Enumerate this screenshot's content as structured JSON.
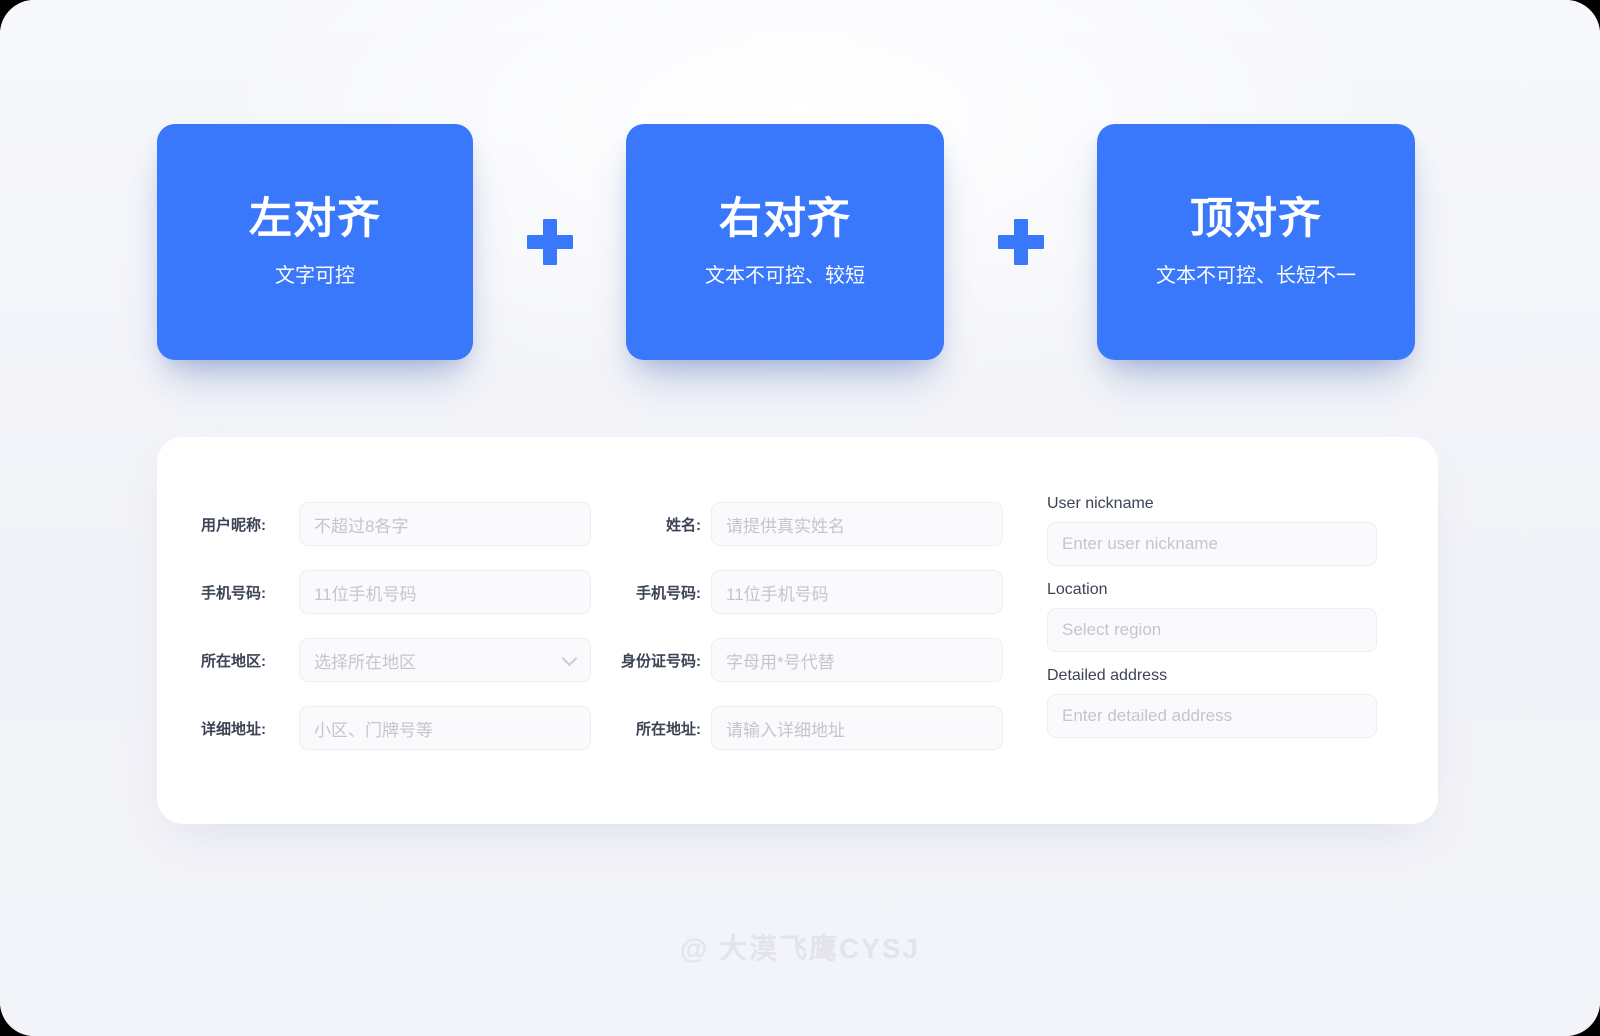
{
  "theme": {
    "accent_blue": "#3a78fb",
    "panel_bg": "#ffffff",
    "canvas_bg": "#f6f7fb",
    "label_color": "#3c4354",
    "placeholder_color": "#c3c6cd",
    "input_bg": "#fafafc",
    "input_border": "#edeef1",
    "watermark_color": "#e2e4ea"
  },
  "cards": [
    {
      "title": "左对齐",
      "subtitle": "文字可控"
    },
    {
      "title": "右对齐",
      "subtitle": "文本不可控、较短"
    },
    {
      "title": "顶对齐",
      "subtitle": "文本不可控、长短不一"
    }
  ],
  "separators": [
    {
      "icon": "plus-icon",
      "glyph": "+"
    },
    {
      "icon": "plus-icon",
      "glyph": "+"
    }
  ],
  "form": {
    "left_column": {
      "alignment": "left",
      "fields": [
        {
          "label": "用户昵称:",
          "placeholder": "不超过8各字",
          "type": "text"
        },
        {
          "label": "手机号码:",
          "placeholder": "11位手机号码",
          "type": "text"
        },
        {
          "label": "所在地区:",
          "placeholder": "选择所在地区",
          "type": "select"
        },
        {
          "label": "详细地址:",
          "placeholder": "小区、门牌号等",
          "type": "text"
        }
      ]
    },
    "middle_column": {
      "alignment": "right",
      "fields": [
        {
          "label": "姓名:",
          "placeholder": "请提供真实姓名",
          "type": "text"
        },
        {
          "label": "手机号码:",
          "placeholder": "11位手机号码",
          "type": "text"
        },
        {
          "label": "身份证号码:",
          "placeholder": "字母用*号代替",
          "type": "text"
        },
        {
          "label": "所在地址:",
          "placeholder": "请输入详细地址",
          "type": "text"
        }
      ]
    },
    "right_column": {
      "alignment": "top",
      "fields": [
        {
          "label": "User nickname",
          "placeholder": "Enter user nickname",
          "type": "text"
        },
        {
          "label": "Location",
          "placeholder": "Select region",
          "type": "text"
        },
        {
          "label": "Detailed address",
          "placeholder": "Enter detailed address",
          "type": "text"
        }
      ]
    }
  },
  "watermark": {
    "text": "@  大漠飞鹰CYSJ"
  }
}
